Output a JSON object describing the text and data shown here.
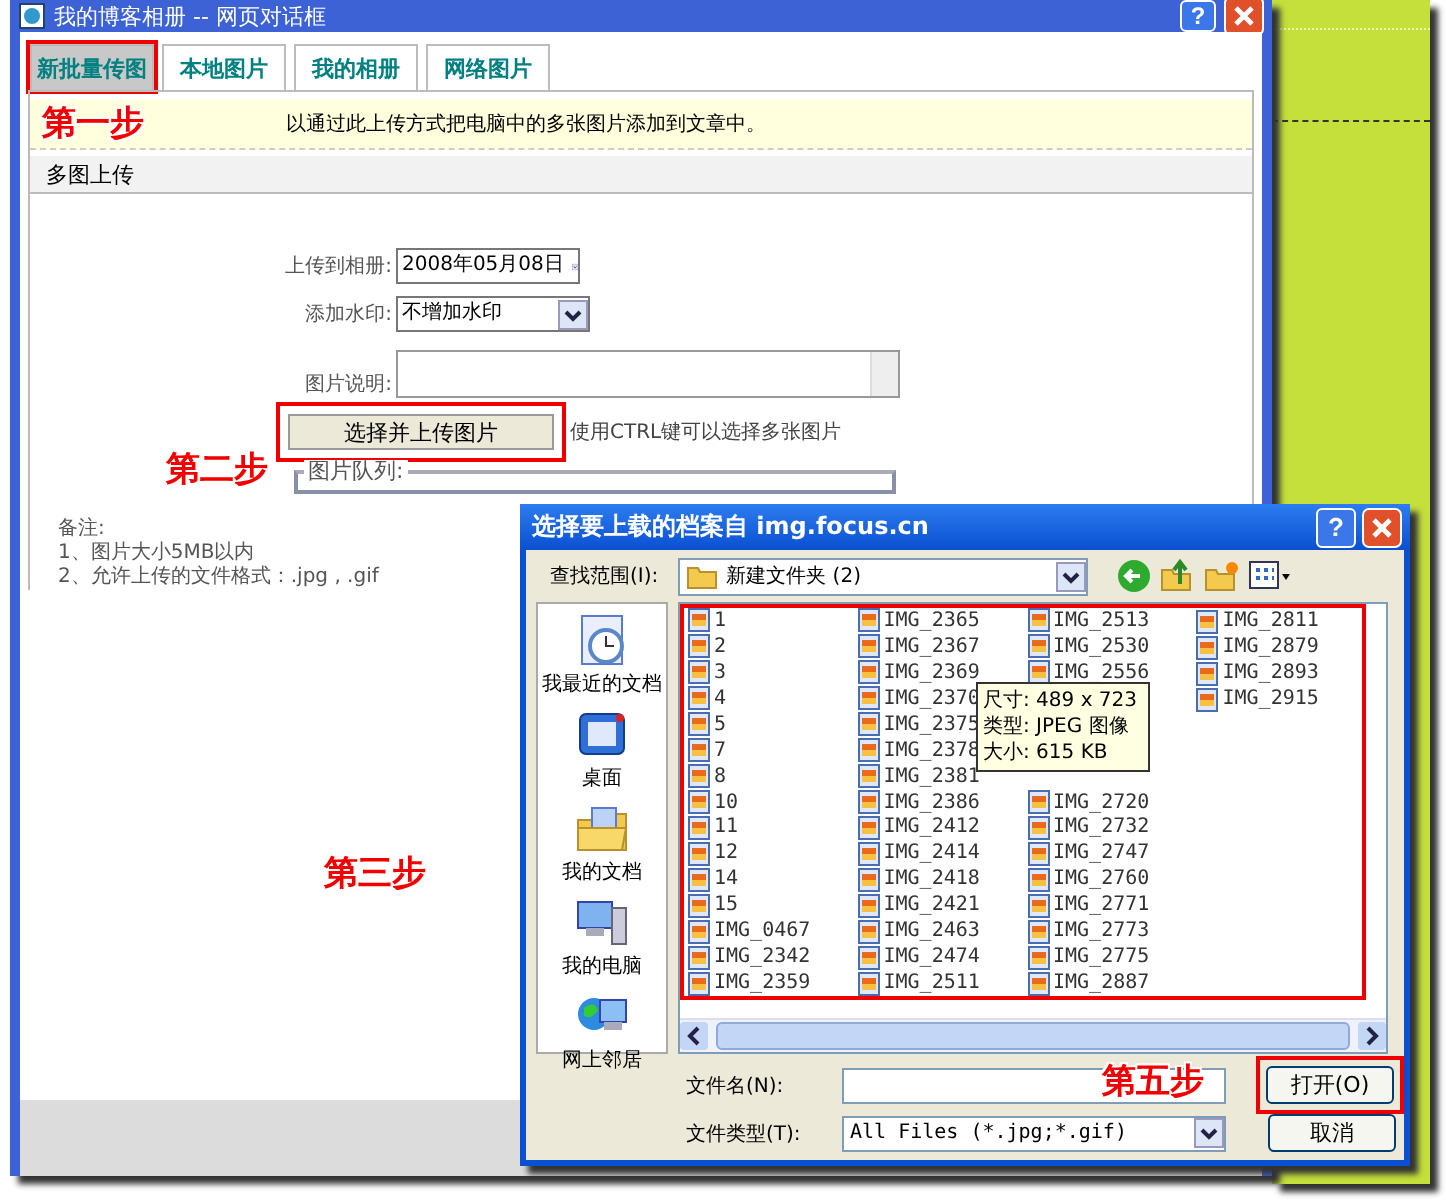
{
  "main_window": {
    "title": "我的博客相册 -- 网页对话框",
    "help_button": "?",
    "tabs": [
      {
        "label": "新批量传图",
        "selected": true,
        "highlighted": true
      },
      {
        "label": "本地图片",
        "selected": false,
        "highlighted": false
      },
      {
        "label": "我的相册",
        "selected": false,
        "highlighted": false
      },
      {
        "label": "网络图片",
        "selected": false,
        "highlighted": false
      }
    ],
    "note": {
      "step_label": "第一步",
      "text": "以通过此上传方式把电脑中的多张图片添加到文章中。"
    },
    "section_title": "多图上传",
    "form": {
      "album_label": "上传到相册:",
      "album_value": "2008年05月08日",
      "watermark_label": "添加水印:",
      "watermark_value": "不增加水印",
      "caption_label": "图片说明:",
      "upload_button": {
        "label": "选择并上传图片",
        "highlighted": true
      },
      "hint": "使用CTRL键可以选择多张图片",
      "step_label": "第二步",
      "queue_label": "图片队列:"
    },
    "remarks": {
      "title": "备注:",
      "lines": [
        "1、图片大小5MB以内",
        "2、允许上传的文件格式：.jpg , .gif"
      ]
    },
    "step_label": "第三步"
  },
  "file_dialog": {
    "title": "选择要上载的档案自 img.focus.cn",
    "help_button": "?",
    "look_in_label": "查找范围(I):",
    "look_in_value": "新建文件夹 (2)",
    "places": [
      "我最近的文档",
      "桌面",
      "我的文档",
      "我的电脑",
      "网上邻居"
    ],
    "file_list": {
      "highlighted": true,
      "columns": [
        {
          "files": [
            "1",
            "2",
            "3",
            "4",
            "5",
            "7",
            "8",
            "10",
            "11",
            "12",
            "14",
            "15",
            "IMG_0467",
            "IMG_2342",
            "IMG_2359"
          ]
        },
        {
          "files": [
            "IMG_2365",
            "IMG_2367",
            "IMG_2369",
            "IMG_2370",
            "IMG_2375",
            "IMG_2378",
            "IMG_2381",
            "IMG_2386",
            "IMG_2412",
            "IMG_2414",
            "IMG_2418",
            "IMG_2421",
            "IMG_2463",
            "IMG_2474",
            "IMG_2511"
          ]
        },
        {
          "files": [
            "IMG_2513",
            "IMG_2530",
            "IMG_2556"
          ],
          "tooltip": [
            "尺寸: 489 x 723",
            "类型: JPEG 图像",
            "大小: 615 KB"
          ],
          "files_after": [
            "IMG_2720",
            "IMG_2732",
            "IMG_2747",
            "IMG_2760",
            "IMG_2771",
            "IMG_2773",
            "IMG_2775",
            "IMG_2887"
          ]
        },
        {
          "files": [
            "IMG_2811",
            "IMG_2879",
            "IMG_2893",
            "IMG_2915"
          ]
        }
      ]
    },
    "filename_label": "文件名(N):",
    "filetype_label": "文件类型(T):",
    "filetype_value": "All Files (*.jpg;*.gif)",
    "open_button": {
      "label": "打开(O)",
      "highlighted": true
    },
    "cancel_button": "取消",
    "step_label": "第五步"
  }
}
